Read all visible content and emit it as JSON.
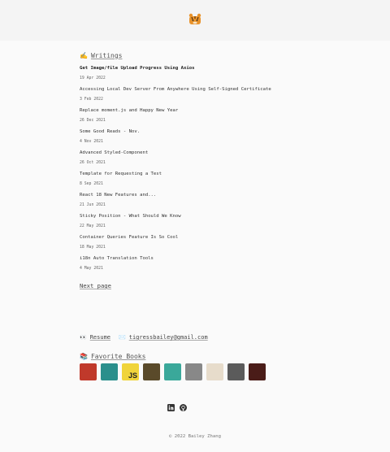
{
  "header": {
    "logo_icon": "tiger-emoji-icon"
  },
  "writings": {
    "emoji": "✍️",
    "title": "Writings",
    "posts": [
      {
        "title": "Get Image/file Upload Progress Using Axios",
        "date": "19 Apr 2022"
      },
      {
        "title": "Accessing Local Dev Server From Anywhere Using Self-Signed Certificate",
        "date": "3 Feb 2022"
      },
      {
        "title": "Replace moment.js and Happy New Year",
        "date": "26 Dec 2021"
      },
      {
        "title": "Some Good Reads - Nov.",
        "date": "4 Nov 2021"
      },
      {
        "title": "Advanced Styled-Component",
        "date": "26 Oct 2021"
      },
      {
        "title": "Template for Requesting a Test",
        "date": "8 Sep 2021"
      },
      {
        "title": "React 18 New Features and...",
        "date": "21 Jun 2021"
      },
      {
        "title": "Sticky Position - What Should We Know",
        "date": "22 May 2021"
      },
      {
        "title": "Container Queries Feature Is So Cool",
        "date": "18 May 2021"
      },
      {
        "title": "i18n Auto Translation Tools",
        "date": "4 May 2021"
      }
    ],
    "next_label": "Next page"
  },
  "links": {
    "resume_emoji": "👀",
    "resume_label": "Resume",
    "email_emoji": "✉️",
    "email": "tigressbailey@gmail.com"
  },
  "books": {
    "emoji": "📚",
    "title": "Favorite Books",
    "covers": [
      {
        "icon": "book-cover-1",
        "color": "#c0392b"
      },
      {
        "icon": "book-cover-2",
        "color": "#2a8f8c"
      },
      {
        "icon": "book-cover-js",
        "color": "#f0d43a",
        "label": "JS"
      },
      {
        "icon": "book-cover-4",
        "color": "#5a4a2a"
      },
      {
        "icon": "book-cover-5",
        "color": "#3aa89a"
      },
      {
        "icon": "book-cover-6",
        "color": "#888888"
      },
      {
        "icon": "book-cover-7",
        "color": "#e7dccb"
      },
      {
        "icon": "book-cover-8",
        "color": "#5b5b5b"
      },
      {
        "icon": "book-cover-9",
        "color": "#4a1c18"
      }
    ]
  },
  "social": {
    "linkedin_icon": "linkedin-icon",
    "github_icon": "github-icon"
  },
  "footer": {
    "copyright": "© 2022 Bailey Zhang"
  }
}
